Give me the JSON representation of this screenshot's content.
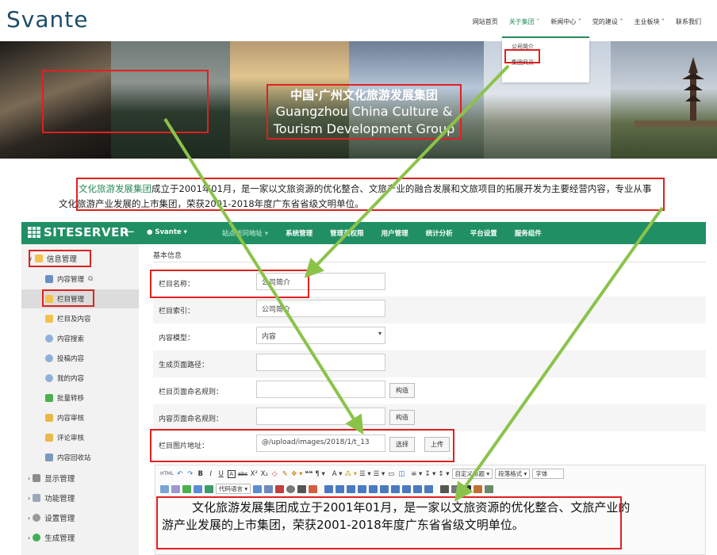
{
  "site": {
    "logo": "Svante",
    "nav": [
      "网站首页",
      "关于集团 ˅",
      "新闻中心 ˅",
      "党的建设 ˅",
      "主业板块 ˅",
      "联系我们"
    ],
    "dropdown": [
      "公司简介",
      "集团风采"
    ],
    "banner_title_cn": "中国·广州文化旅游发展集团",
    "banner_title_en_1": "Guangzhou China Culture &",
    "banner_title_en_2": "Tourism Development Group"
  },
  "intro": {
    "link": "文化旅游发展集团",
    "line1": "成立于2001年01月，是一家以文旅资源的优化整合、文旅产业的融合发展和文旅项目的拓展开发为主要经营内容，专业从事",
    "line2": "文化旅游产业发展的上市集团，荣获2001-2018年度广东省省级文明单位。"
  },
  "admin": {
    "logo": "SITESERVER",
    "svante": "Svante ▾",
    "menu": [
      "站点访问地址 ▾",
      "系统管理",
      "管理员权限",
      "用户管理",
      "统计分析",
      "平台设置",
      "服务组件"
    ],
    "sidebar": [
      {
        "label": "信息管理",
        "icon": "folder-icon"
      },
      {
        "label": "内容管理",
        "icon": "list-icon"
      },
      {
        "label": "栏目管理",
        "icon": "folder-icon"
      },
      {
        "label": "栏目及内容",
        "icon": "folder-icon"
      },
      {
        "label": "内容搜索",
        "icon": "search-icon"
      },
      {
        "label": "投稿内容",
        "icon": "search-icon"
      },
      {
        "label": "我的内容",
        "icon": "search-icon"
      },
      {
        "label": "批量转移",
        "icon": "transfer-icon"
      },
      {
        "label": "内容审核",
        "icon": "shield-icon"
      },
      {
        "label": "评论审核",
        "icon": "shield-icon"
      },
      {
        "label": "内容回收站",
        "icon": "recycle-icon"
      },
      {
        "label": "显示管理",
        "icon": "display-icon"
      },
      {
        "label": "功能管理",
        "icon": "wrench-icon"
      },
      {
        "label": "设置管理",
        "icon": "gear-icon"
      },
      {
        "label": "生成管理",
        "icon": "globe-icon"
      }
    ],
    "breadcrumb": "基本信息",
    "form": {
      "name_label": "栏目名称：",
      "name_value": "公司简介",
      "index_label": "栏目索引：",
      "index_value": "公司简介",
      "model_label": "内容模型：",
      "model_value": "内容",
      "path_label": "生成页面路径：",
      "path_value": "",
      "page_rule_label": "栏目页面命名规则：",
      "content_rule_label": "内容页面命名规则：",
      "build_button": "构造",
      "image_label": "栏目图片地址：",
      "image_value": "@/upload/images/2018/1/t_13",
      "select_button": "选择",
      "upload_button": "上传"
    },
    "editor": {
      "toolbar1": [
        "HTML",
        "↶",
        "↷",
        "B",
        "I",
        "U",
        "A",
        "abc",
        "X²",
        "X₂",
        "◇",
        "✎",
        "✥ ▾",
        "❝❝",
        "¶ ▾",
        "A ▾",
        "⁂ ▾",
        "☰ ▾",
        "☰ ▾",
        "▭",
        "◫",
        "≡ ▾",
        "↧ ▾",
        "↕ ▾"
      ],
      "selects1": [
        "自定义标题 ▾",
        "段落格式 ▾",
        "字体"
      ],
      "toolbar2_mid": "代码语言 ▾",
      "content_line1": "        文化旅游发展集团成立于2001年01月，是一家以文旅资源的优化整合、文旅产业的",
      "content_line2": "游产业发展的上市集团，荣获2001-2018年度广东省省级文明单位。"
    }
  }
}
